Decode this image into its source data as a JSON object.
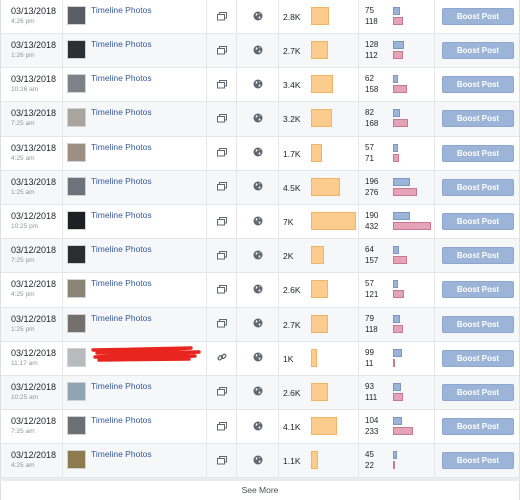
{
  "posts": [
    {
      "date": "03/13/2018",
      "time": "4:26 pm",
      "title": "Timeline Photos",
      "type_icon": "photo-album-icon",
      "target_icon": "globe-icon",
      "reach": "2.8K",
      "reach_value": 2800,
      "eng_a": "75",
      "eng_b": "118",
      "boost": "Boost Post",
      "thumb": "#5a5e64"
    },
    {
      "date": "03/13/2018",
      "time": "1:26 pm",
      "title": "Timeline Photos",
      "type_icon": "photo-album-icon",
      "target_icon": "globe-icon",
      "reach": "2.7K",
      "reach_value": 2700,
      "eng_a": "128",
      "eng_b": "112",
      "boost": "Boost Post",
      "thumb": "#2c2f33"
    },
    {
      "date": "03/13/2018",
      "time": "10:26 am",
      "title": "Timeline Photos",
      "type_icon": "photo-album-icon",
      "target_icon": "globe-icon",
      "reach": "3.4K",
      "reach_value": 3400,
      "eng_a": "62",
      "eng_b": "158",
      "boost": "Boost Post",
      "thumb": "#7d8288"
    },
    {
      "date": "03/13/2018",
      "time": "7:25 am",
      "title": "Timeline Photos",
      "type_icon": "photo-album-icon",
      "target_icon": "globe-icon",
      "reach": "3.2K",
      "reach_value": 3200,
      "eng_a": "82",
      "eng_b": "168",
      "boost": "Boost Post",
      "thumb": "#a9a49e"
    },
    {
      "date": "03/13/2018",
      "time": "4:25 am",
      "title": "Timeline Photos",
      "type_icon": "photo-album-icon",
      "target_icon": "globe-icon",
      "reach": "1.7K",
      "reach_value": 1700,
      "eng_a": "57",
      "eng_b": "71",
      "boost": "Boost Post",
      "thumb": "#9d8f86"
    },
    {
      "date": "03/13/2018",
      "time": "1:25 am",
      "title": "Timeline Photos",
      "type_icon": "photo-album-icon",
      "target_icon": "globe-icon",
      "reach": "4.5K",
      "reach_value": 4500,
      "eng_a": "196",
      "eng_b": "276",
      "boost": "Boost Post",
      "thumb": "#6d737a"
    },
    {
      "date": "03/12/2018",
      "time": "10:25 pm",
      "title": "Timeline Photos",
      "type_icon": "photo-album-icon",
      "target_icon": "globe-icon",
      "reach": "7K",
      "reach_value": 7000,
      "eng_a": "190",
      "eng_b": "432",
      "boost": "Boost Post",
      "thumb": "#1e2024"
    },
    {
      "date": "03/12/2018",
      "time": "7:25 pm",
      "title": "Timeline Photos",
      "type_icon": "photo-album-icon",
      "target_icon": "globe-icon",
      "reach": "2K",
      "reach_value": 2000,
      "eng_a": "64",
      "eng_b": "157",
      "boost": "Boost Post",
      "thumb": "#2b2d31"
    },
    {
      "date": "03/12/2018",
      "time": "4:25 pm",
      "title": "Timeline Photos",
      "type_icon": "photo-album-icon",
      "target_icon": "globe-icon",
      "reach": "2.6K",
      "reach_value": 2600,
      "eng_a": "57",
      "eng_b": "121",
      "boost": "Boost Post",
      "thumb": "#8a8478"
    },
    {
      "date": "03/12/2018",
      "time": "1:25 pm",
      "title": "Timeline Photos",
      "type_icon": "photo-album-icon",
      "target_icon": "globe-icon",
      "reach": "2.7K",
      "reach_value": 2700,
      "eng_a": "79",
      "eng_b": "118",
      "boost": "Boost Post",
      "thumb": "#74706c"
    },
    {
      "date": "03/12/2018",
      "time": "11:17 am",
      "title": "",
      "redacted": true,
      "type_icon": "link-icon",
      "target_icon": "globe-icon",
      "reach": "1K",
      "reach_value": 1000,
      "eng_a": "99",
      "eng_b": "11",
      "boost": "Boost Post",
      "thumb": "#b7bbc0"
    },
    {
      "date": "03/12/2018",
      "time": "10:25 am",
      "title": "Timeline Photos",
      "type_icon": "photo-album-icon",
      "target_icon": "globe-icon",
      "reach": "2.6K",
      "reach_value": 2600,
      "eng_a": "93",
      "eng_b": "111",
      "boost": "Boost Post",
      "thumb": "#8fa3b2"
    },
    {
      "date": "03/12/2018",
      "time": "7:25 am",
      "title": "Timeline Photos",
      "type_icon": "photo-album-icon",
      "target_icon": "globe-icon",
      "reach": "4.1K",
      "reach_value": 4100,
      "eng_a": "104",
      "eng_b": "233",
      "boost": "Boost Post",
      "thumb": "#6c6f73"
    },
    {
      "date": "03/12/2018",
      "time": "4:25 am",
      "title": "Timeline Photos",
      "type_icon": "photo-album-icon",
      "target_icon": "globe-icon",
      "reach": "1.1K",
      "reach_value": 1100,
      "eng_a": "45",
      "eng_b": "22",
      "boost": "Boost Post",
      "thumb": "#8d7a4e"
    }
  ],
  "footer": {
    "see_more": "See More"
  },
  "colors": {
    "link": "#365899",
    "reach_bar": "#fccc8e",
    "eng_bar_a": "#9cb4d8",
    "eng_bar_b": "#e4a3b7",
    "boost_button": "#9cb4d8"
  }
}
